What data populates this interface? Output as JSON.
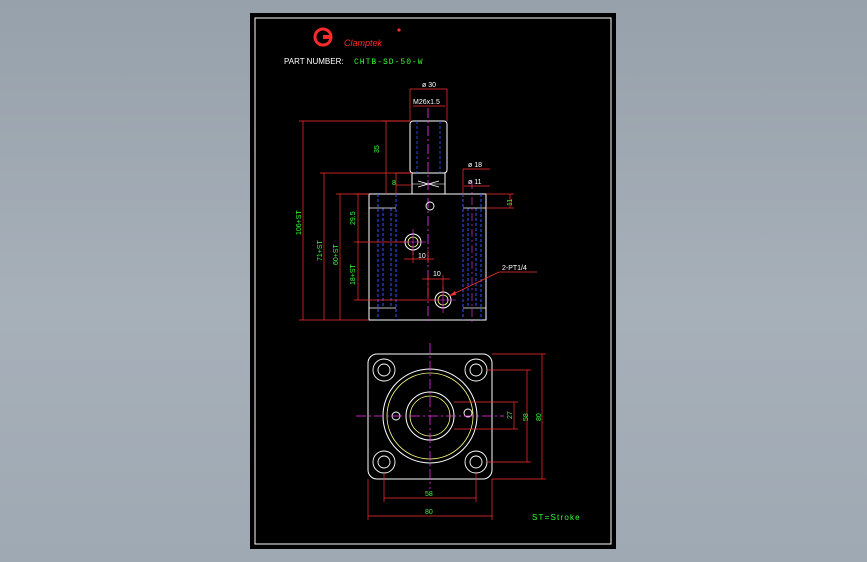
{
  "brand": {
    "name": "Clamptek",
    "mark": "G"
  },
  "part_number": {
    "label": "PART  NUMBER:",
    "value": "CHTB-SD-50-W"
  },
  "front_view": {
    "dia_top": "ø 30",
    "thread": "M26x1.5",
    "dia_18": "ø 18",
    "dia_11": "ø 11",
    "dim_35": "35",
    "dim_8": "8",
    "dim_11": "11",
    "dim_29_5": "29.5",
    "dim_106_st": "106+ST",
    "dim_71_st": "71+ST",
    "dim_60_st": "60+ST",
    "dim_18_st": "18+ST",
    "dim_10_a": "10",
    "dim_10_b": "10",
    "port_label": "2-PT1/4"
  },
  "top_view": {
    "dim_27": "27",
    "dim_58_v": "58",
    "dim_80_v": "80",
    "dim_58_h": "58",
    "dim_80_h": "80"
  },
  "legend": {
    "stroke_note": "ST=Stroke"
  },
  "colors": {
    "background": "#000000",
    "frame": "#ffffff",
    "dimension": "#ff3030",
    "dim_text": "#33ff33",
    "centerline": "#ff33ff",
    "hidden": "#3355ff",
    "brand": "#ff2a2a",
    "bore": "#ffff80"
  }
}
